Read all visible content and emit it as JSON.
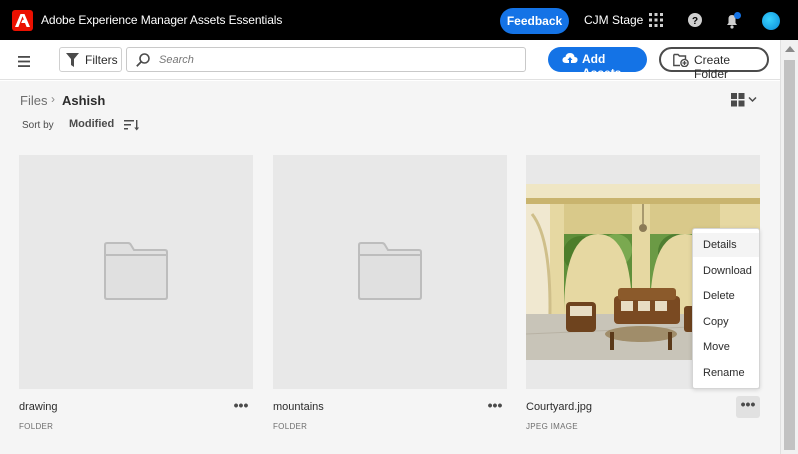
{
  "app": {
    "title": "Adobe Experience Manager Assets Essentials",
    "feedback_label": "Feedback",
    "org_name": "CJM Stage",
    "icons": [
      "adobe-logo-icon",
      "apps-grid-icon",
      "help-icon",
      "bell-icon",
      "avatar"
    ],
    "brand_color": "#eb1000",
    "accent_color": "#1473e6"
  },
  "toolbar": {
    "filters_label": "Filters",
    "search_placeholder": "Search",
    "add_assets_label": "Add Assets",
    "create_folder_label": "Create Folder"
  },
  "breadcrumb": {
    "root": "Files",
    "separator": "›",
    "current": "Ashish"
  },
  "sort": {
    "label": "Sort by",
    "value": "Modified"
  },
  "assets": [
    {
      "name": "drawing",
      "type": "FOLDER"
    },
    {
      "name": "mountains",
      "type": "FOLDER"
    },
    {
      "name": "Courtyard.jpg",
      "type": "JPEG IMAGE"
    }
  ],
  "more_label": "•••",
  "context_menu": {
    "items": [
      "Details",
      "Download",
      "Delete",
      "Copy",
      "Move",
      "Rename"
    ],
    "hovered": "Details"
  }
}
